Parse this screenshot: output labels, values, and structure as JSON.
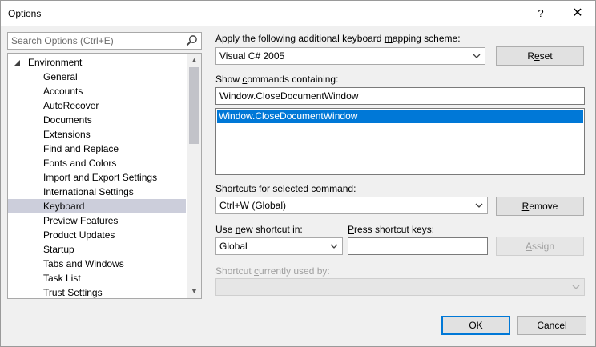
{
  "window": {
    "title": "Options",
    "help_glyph": "?",
    "close_glyph": "✕"
  },
  "search": {
    "placeholder": "Search Options (Ctrl+E)"
  },
  "tree": {
    "root_label": "Environment",
    "items": [
      "General",
      "Accounts",
      "AutoRecover",
      "Documents",
      "Extensions",
      "Find and Replace",
      "Fonts and Colors",
      "Import and Export Settings",
      "International Settings",
      "Keyboard",
      "Preview Features",
      "Product Updates",
      "Startup",
      "Tabs and Windows",
      "Task List",
      "Trust Settings"
    ],
    "selected": "Keyboard"
  },
  "mapping": {
    "label_pre": "Apply the following additional keyboard ",
    "label_accel": "m",
    "label_post": "apping scheme:",
    "value": "Visual C# 2005",
    "reset_pre": "R",
    "reset_accel": "e",
    "reset_post": "set"
  },
  "commands": {
    "label_pre": "Show ",
    "label_accel": "c",
    "label_post": "ommands containing:",
    "filter_value": "Window.CloseDocumentWindow",
    "list_selected": "Window.CloseDocumentWindow"
  },
  "shortcuts": {
    "label_pre": "Shor",
    "label_accel": "t",
    "label_post": "cuts for selected command:",
    "value": "Ctrl+W (Global)",
    "remove_pre": "",
    "remove_accel": "R",
    "remove_post": "emove"
  },
  "new_shortcut": {
    "use_pre": "Use ",
    "use_accel": "n",
    "use_post": "ew shortcut in:",
    "scope_value": "Global",
    "press_pre": "",
    "press_accel": "P",
    "press_post": "ress shortcut keys:",
    "keys_value": "",
    "assign_pre": "",
    "assign_accel": "A",
    "assign_post": "ssign"
  },
  "used_by": {
    "label_pre": "Shortcut ",
    "label_accel": "c",
    "label_post": "urrently used by:",
    "value": ""
  },
  "footer": {
    "ok_label": "OK",
    "cancel_label": "Cancel"
  },
  "colors": {
    "selection": "#0078d7",
    "tree_selection": "#cccedb"
  }
}
